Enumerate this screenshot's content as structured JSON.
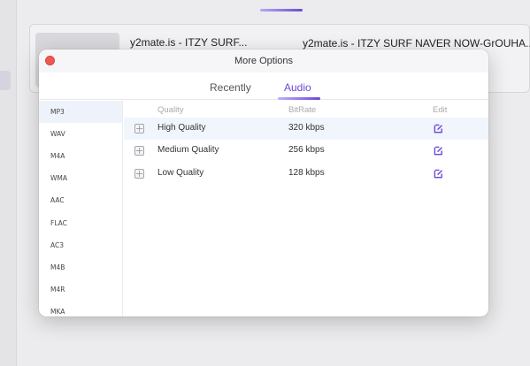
{
  "background": {
    "video_title_short": "y2mate.is - ITZY SURF...",
    "video_title_long": "y2mate.is - ITZY SURF NAVER NOW-GrOUHA..."
  },
  "modal": {
    "title": "More Options",
    "tabs": [
      {
        "label": "Recently",
        "active": false
      },
      {
        "label": "Audio",
        "active": true
      }
    ],
    "formats": [
      "MP3",
      "WAV",
      "M4A",
      "WMA",
      "AAC",
      "FLAC",
      "AC3",
      "M4B",
      "M4R",
      "MKA"
    ],
    "selected_format": "MP3",
    "columns": {
      "quality": "Quality",
      "bitrate": "BitRate",
      "edit": "Edit"
    },
    "rows": [
      {
        "quality": "High Quality",
        "bitrate": "320 kbps"
      },
      {
        "quality": "Medium Quality",
        "bitrate": "256 kbps"
      },
      {
        "quality": "Low Quality",
        "bitrate": "128 kbps"
      }
    ]
  },
  "colors": {
    "accent": "#6a46d8",
    "close_button": "#ee5a52",
    "selected_row": "#f1f5fc"
  }
}
